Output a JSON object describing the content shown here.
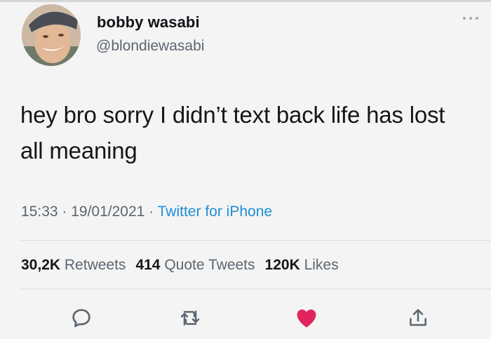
{
  "author": {
    "name": "bobby wasabi",
    "handle": "@blondiewasabi",
    "avatar_icon": "profile-photo"
  },
  "tweet": {
    "text": "hey bro sorry I didn’t text back life has lost all meaning",
    "time": "15:33",
    "sep1": " · ",
    "date": "19/01/2021",
    "sep2": " · ",
    "source": "Twitter for iPhone"
  },
  "stats": {
    "retweets_count": "30,2K",
    "retweets_label": "Retweets",
    "quotes_count": "414",
    "quotes_label": "Quote Tweets",
    "likes_count": "120K",
    "likes_label": "Likes"
  },
  "actions": {
    "reply_icon": "reply-icon",
    "retweet_icon": "retweet-icon",
    "like_icon": "heart-icon",
    "share_icon": "share-icon"
  },
  "colors": {
    "like": "#e0245e",
    "link": "#1d8fd8",
    "secondary_text": "#5b6670"
  }
}
